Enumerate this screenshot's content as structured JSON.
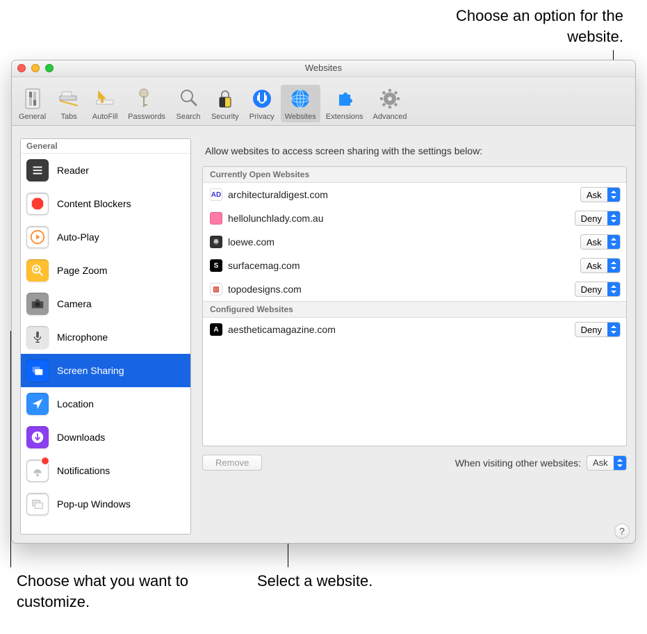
{
  "callouts": {
    "choose_option": "Choose an option for the website.",
    "select_website": "Select a website.",
    "choose_customize": "Choose what you want to customize."
  },
  "window": {
    "title": "Websites",
    "help_tooltip": "?"
  },
  "toolbar": {
    "items": [
      {
        "label": "General"
      },
      {
        "label": "Tabs"
      },
      {
        "label": "AutoFill"
      },
      {
        "label": "Passwords"
      },
      {
        "label": "Search"
      },
      {
        "label": "Security"
      },
      {
        "label": "Privacy"
      },
      {
        "label": "Websites"
      },
      {
        "label": "Extensions"
      },
      {
        "label": "Advanced"
      }
    ],
    "selected_index": 7
  },
  "sidebar": {
    "title": "General",
    "items": [
      {
        "label": "Reader"
      },
      {
        "label": "Content Blockers"
      },
      {
        "label": "Auto-Play"
      },
      {
        "label": "Page Zoom"
      },
      {
        "label": "Camera"
      },
      {
        "label": "Microphone"
      },
      {
        "label": "Screen Sharing"
      },
      {
        "label": "Location"
      },
      {
        "label": "Downloads"
      },
      {
        "label": "Notifications"
      },
      {
        "label": "Pop-up Windows"
      }
    ],
    "selected_index": 6
  },
  "main": {
    "heading": "Allow websites to access screen sharing with the settings below:",
    "sections": {
      "open": {
        "title": "Currently Open Websites",
        "rows": [
          {
            "favicon": "AD",
            "favicon_bg": "#ffffff",
            "favicon_fg": "#3333cc",
            "host": "architecturaldigest.com",
            "value": "Ask"
          },
          {
            "favicon": "",
            "favicon_bg": "#ff7aa8",
            "favicon_fg": "#ffffff",
            "host": "hellolunchlady.com.au",
            "value": "Deny"
          },
          {
            "favicon": "※",
            "favicon_bg": "#333333",
            "favicon_fg": "#ffffff",
            "host": "loewe.com",
            "value": "Ask"
          },
          {
            "favicon": "S",
            "favicon_bg": "#000000",
            "favicon_fg": "#ffffff",
            "host": "surfacemag.com",
            "value": "Ask"
          },
          {
            "favicon": "▥",
            "favicon_bg": "#ffffff",
            "favicon_fg": "#d63a2a",
            "host": "topodesigns.com",
            "value": "Deny"
          }
        ]
      },
      "configured": {
        "title": "Configured Websites",
        "rows": [
          {
            "favicon": "A",
            "favicon_bg": "#000000",
            "favicon_fg": "#ffffff",
            "host": "aestheticamagazine.com",
            "value": "Deny"
          }
        ]
      }
    },
    "remove_label": "Remove",
    "footer_label": "When visiting other websites:",
    "footer_value": "Ask"
  }
}
